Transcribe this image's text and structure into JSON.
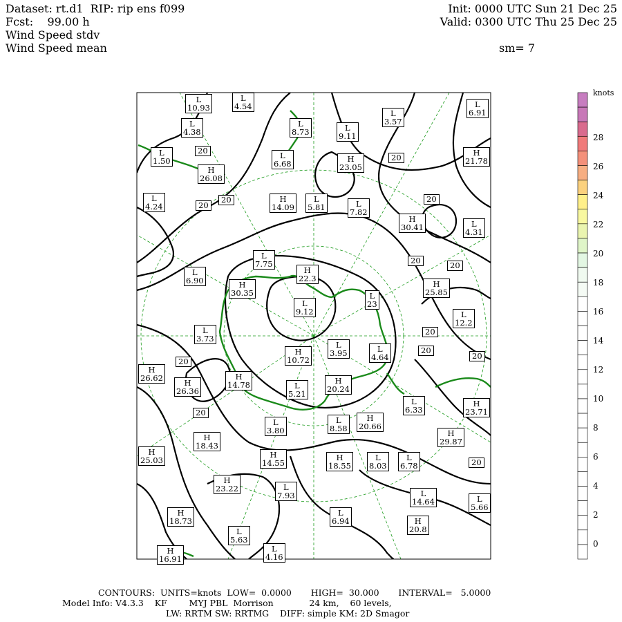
{
  "header": {
    "dataset": "Dataset: rt.d1  RIP: rip ens f099",
    "fcst": "Fcst:    99.00 h",
    "field1": "Wind Speed stdv",
    "field2": "Wind Speed mean",
    "init": "Init: 0000 UTC Sun 21 Dec 25",
    "valid": "Valid: 0300 UTC Thu 25 Dec 25",
    "smooth": "sm= 7"
  },
  "colorbar": {
    "units": "knots",
    "labels": [
      "28",
      "26",
      "24",
      "22",
      "20",
      "18",
      "16",
      "14",
      "12",
      "10",
      "8",
      "6",
      "4",
      "2",
      "0"
    ],
    "colors": [
      "#c77dc0",
      "#c878b8",
      "#d96b8e",
      "#f07a7a",
      "#f4907a",
      "#f7ae82",
      "#fbd17e",
      "#fff08a",
      "#f8f8a0",
      "#eaf5b0",
      "#dff5c8",
      "#e3f7e3",
      "#f0faf0",
      "#f5fbf5",
      "#ffffff",
      "#ffffff",
      "#ffffff",
      "#ffffff",
      "#ffffff",
      "#ffffff",
      "#ffffff",
      "#ffffff",
      "#ffffff",
      "#ffffff",
      "#ffffff",
      "#ffffff",
      "#ffffff",
      "#ffffff",
      "#ffffff",
      "#ffffff",
      "#ffffff",
      "#ffffff"
    ]
  },
  "extrema": [
    {
      "t": "L",
      "v": "10.93"
    },
    {
      "t": "L",
      "v": "4.54"
    },
    {
      "t": "L",
      "v": "4.38"
    },
    {
      "t": "L",
      "v": "8.73"
    },
    {
      "t": "L",
      "v": "9.11"
    },
    {
      "t": "L",
      "v": "3.57"
    },
    {
      "t": "L",
      "v": "6.91"
    },
    {
      "t": "L",
      "v": "1.50"
    },
    {
      "t": "H",
      "v": "26.08"
    },
    {
      "t": "L",
      "v": "6.68"
    },
    {
      "t": "H",
      "v": "23.05"
    },
    {
      "t": "H",
      "v": "21.78"
    },
    {
      "t": "L",
      "v": "4.24"
    },
    {
      "t": "H",
      "v": "14.09"
    },
    {
      "t": "L",
      "v": "5.81"
    },
    {
      "t": "L",
      "v": "7.82"
    },
    {
      "t": "H",
      "v": "30.41"
    },
    {
      "t": "L",
      "v": "4.31"
    },
    {
      "t": "L",
      "v": "7.75"
    },
    {
      "t": "L",
      "v": "6.90"
    },
    {
      "t": "H",
      "v": "22.3"
    },
    {
      "t": "H",
      "v": "30.35"
    },
    {
      "t": "L",
      "v": "9.12"
    },
    {
      "t": "L",
      "v": "23"
    },
    {
      "t": "H",
      "v": "25.85"
    },
    {
      "t": "L",
      "v": "12.2"
    },
    {
      "t": "L",
      "v": "3.73"
    },
    {
      "t": "H",
      "v": "10.72"
    },
    {
      "t": "L",
      "v": "3.95"
    },
    {
      "t": "L",
      "v": "4.64"
    },
    {
      "t": "H",
      "v": "26.62"
    },
    {
      "t": "H",
      "v": "26.36"
    },
    {
      "t": "H",
      "v": "14.78"
    },
    {
      "t": "L",
      "v": "5.21"
    },
    {
      "t": "H",
      "v": "20.24"
    },
    {
      "t": "L",
      "v": "6.33"
    },
    {
      "t": "H",
      "v": "23.71"
    },
    {
      "t": "L",
      "v": "3.80"
    },
    {
      "t": "L",
      "v": "8.58"
    },
    {
      "t": "H",
      "v": "20.66"
    },
    {
      "t": "H",
      "v": "18.43"
    },
    {
      "t": "H",
      "v": "29.87"
    },
    {
      "t": "H",
      "v": "25.03"
    },
    {
      "t": "H",
      "v": "14.55"
    },
    {
      "t": "H",
      "v": "18.55"
    },
    {
      "t": "L",
      "v": "8.03"
    },
    {
      "t": "L",
      "v": "6.78"
    },
    {
      "t": "H",
      "v": "23.22"
    },
    {
      "t": "L",
      "v": "7.93"
    },
    {
      "t": "L",
      "v": "14.64"
    },
    {
      "t": "L",
      "v": "5.66"
    },
    {
      "t": "H",
      "v": "18.73"
    },
    {
      "t": "L",
      "v": "6.94"
    },
    {
      "t": "H",
      "v": "20.8"
    },
    {
      "t": "L",
      "v": "5.63"
    },
    {
      "t": "L",
      "v": "4.16"
    },
    {
      "t": "H",
      "v": "16.91"
    }
  ],
  "contour_label": "20",
  "footer": {
    "line1": "CONTOURS:  UNITS=knots  LOW=  0.0000       HIGH=  30.000       INTERVAL=   5.0000",
    "line2": "Model Info: V4.3.3    KF        MYJ PBL  Morrison             24 km,    60 levels,",
    "line3": "LW: RRTM SW: RRTMG    DIFF: simple KM: 2D Smagor"
  }
}
